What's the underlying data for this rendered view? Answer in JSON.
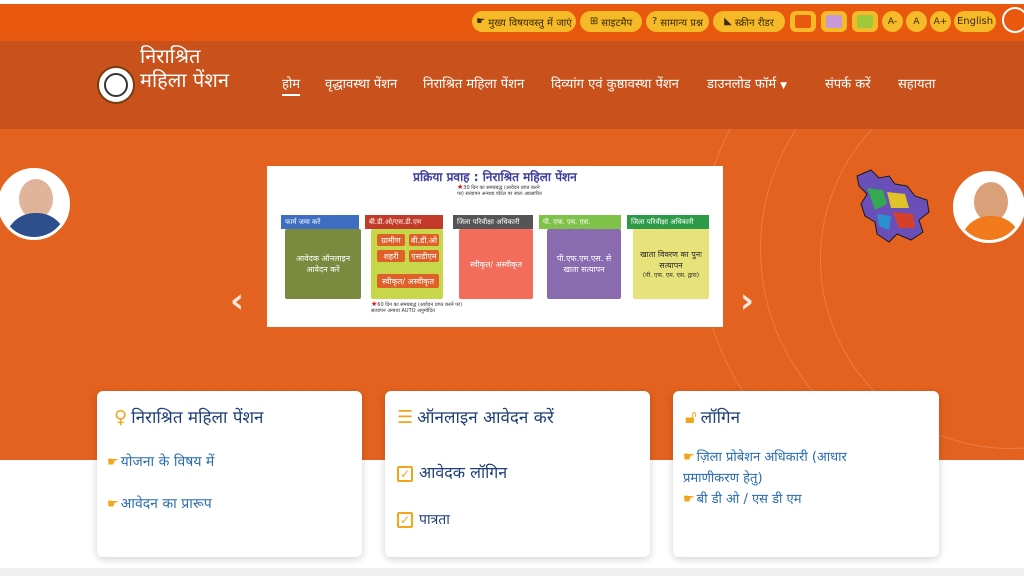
{
  "utility_bar": {
    "skip_to_main": "मुख्य विषयवस्तु में जाएं",
    "sitemap": "साइटमैप",
    "faq": "सामान्य प्रश्न",
    "screen_reader": "स्क्रीन रीडर",
    "font_decrease": "A-",
    "font_normal": "A",
    "font_increase": "A+",
    "language": "English",
    "theme_colors": [
      "#e8590f",
      "#c79ad6",
      "#9ec93b"
    ]
  },
  "header": {
    "site_title": "निराश्रित महिला पेंशन",
    "nav": [
      {
        "label": "होम"
      },
      {
        "label": "वृद्धावस्था पेंशन"
      },
      {
        "label": "निराश्रित महिला पेंशन"
      },
      {
        "label": "दिव्यांग एवं कुष्ठावस्था पेंशन"
      },
      {
        "label": "डाउनलोड फॉर्म"
      },
      {
        "label": "संपर्क करें"
      },
      {
        "label": "सहायता"
      }
    ]
  },
  "slide": {
    "title": "प्रक्रिया प्रवाह : निराश्रित महिला पेंशन",
    "steps": [
      {
        "head": "फार्म जमा करें",
        "body": "आवेदक ऑनलाइन आवेदन करें"
      },
      {
        "head": "बी.डी.ओ/एस.डी.एम",
        "body": "स्वीकृत/ अस्वीकृत"
      },
      {
        "head": "जिला परिवीक्षा अधिकारी",
        "body": "स्वीकृत/ अस्वीकृत"
      },
      {
        "head": "पी. एफ. एम. एस.",
        "body": "पी.एफ.एम.एस. से खाता सत्यापन"
      },
      {
        "head": "जिला परिवीक्षा अधिकारी",
        "body": "खाता विवरण का पुनः सत्यापन"
      }
    ],
    "step2_rural": "ग्रामीण",
    "step2_urban": "शहरी",
    "step2_bdo": "बी.डी.ओ",
    "step2_sdm": "एसडीएम",
    "step5_sub": "(पी. एफ. एम. एस. द्वारा)",
    "note_top": "30 दिन का समयबद्ध (आवेदन प्राप्त करने पर) सत्यापन अन्यथा पोर्टल पर स्वतः अग्रसारित",
    "note_bottom": "60 दिन का समयबद्ध (आवेदन प्राप्त करने पर) सत्यापन अन्यथा AUTO अनुमोदित"
  },
  "cards": {
    "scheme": {
      "title": "निराश्रित महिला पेंशन",
      "links": [
        "योजना के विषय में",
        "आवेदन का प्रारूप"
      ]
    },
    "apply": {
      "title": "ऑनलाइन आवेदन करें",
      "links": [
        "आवेदक लॉगिन",
        "पात्रता"
      ]
    },
    "login": {
      "title": "लॉगिन",
      "links": [
        "ज़िला प्रोबेशन अधिकारी (आधार प्रमाणीकरण हेतु)",
        "बी डी ओ / एस डी एम"
      ]
    }
  },
  "colors": {
    "header": "#c9521c",
    "hero": "#e3621f",
    "accent": "#f6b928",
    "link": "#2b6cb0"
  }
}
